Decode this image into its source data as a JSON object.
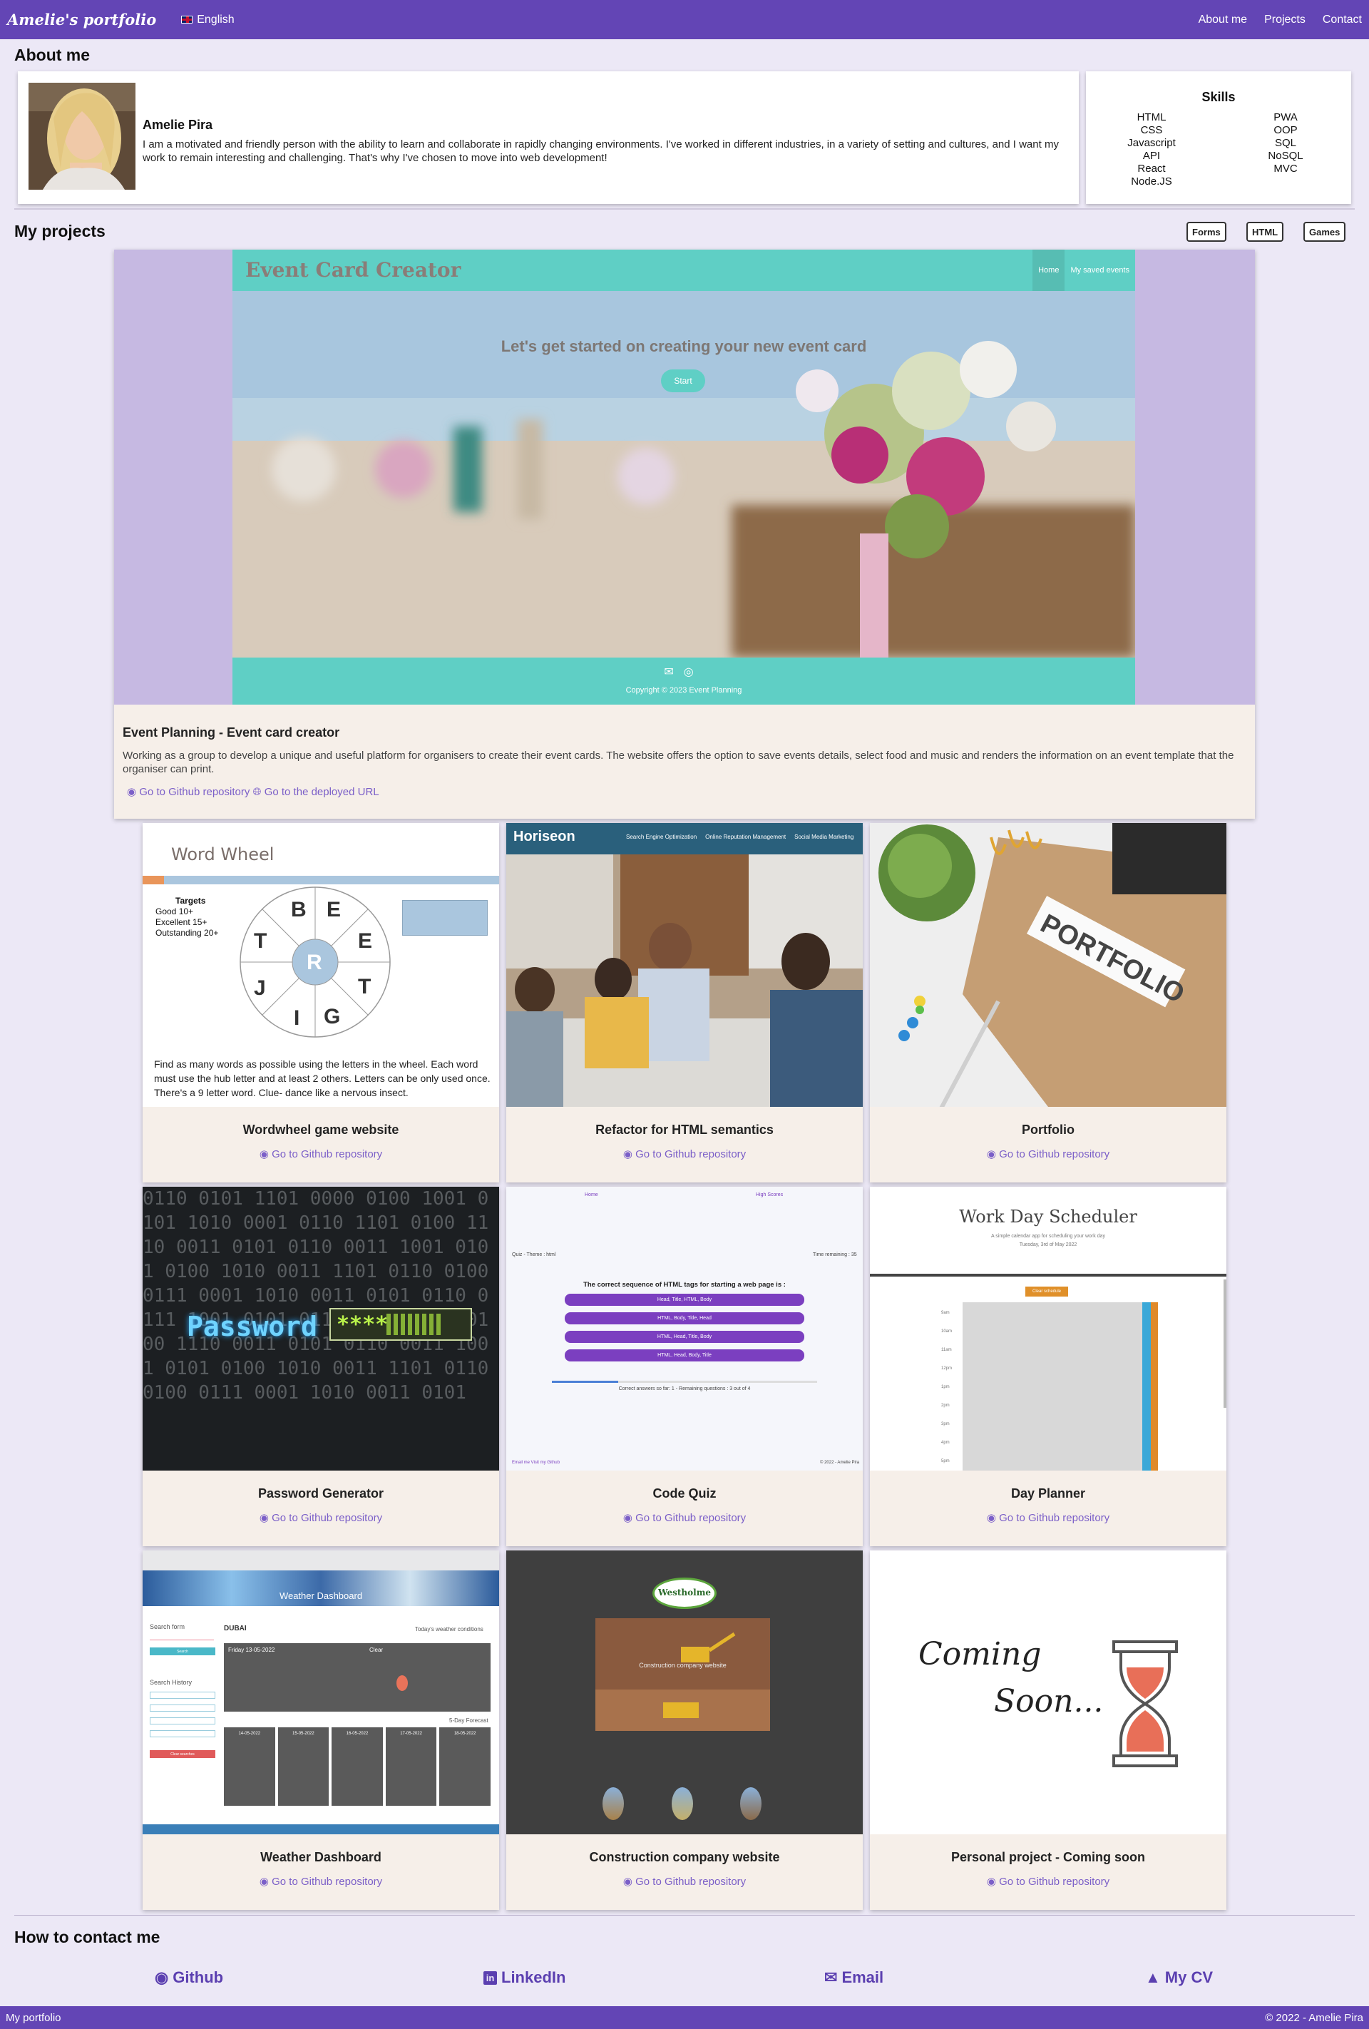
{
  "nav": {
    "brand": "Amelie's portfolio",
    "language": "English",
    "links": [
      "About me",
      "Projects",
      "Contact"
    ]
  },
  "about": {
    "title": "About me",
    "name": "Amelie Pira",
    "text": "I am a motivated and friendly person with the ability to learn and collaborate in rapidly changing environments. I've worked in different industries, in a variety of setting and cultures, and I want my work to remain interesting and challenging. That's why I've chosen to move into web development!",
    "skills_title": "Skills",
    "skills_left": [
      "HTML",
      "CSS",
      "Javascript",
      "API",
      "React",
      "Node.JS"
    ],
    "skills_right": [
      "PWA",
      "OOP",
      "SQL",
      "NoSQL",
      "MVC"
    ]
  },
  "projects": {
    "title": "My projects",
    "filters": [
      "Forms",
      "HTML",
      "Games"
    ],
    "featured": {
      "screenshot": {
        "title": "Event Card Creator",
        "nav_home": "Home",
        "nav_saved": "My saved events",
        "message": "Let's get started on creating your new event card",
        "start": "Start",
        "copyright": "Copyright © 2023 Event Planning"
      },
      "title": "Event Planning - Event card creator",
      "description": "Working as a group to develop a unique and useful platform for organisers to create their event cards. The website offers the option to save events details, select food and music and renders the information on an event template that the organiser can print.",
      "repo_link": "Go to Github repository",
      "deploy_link": "Go to the deployed URL"
    },
    "cards": [
      {
        "title": "Wordwheel game website",
        "link": "Go to Github repository"
      },
      {
        "title": "Refactor for HTML semantics",
        "link": "Go to Github repository"
      },
      {
        "title": "Portfolio",
        "link": "Go to Github repository"
      },
      {
        "title": "Password Generator",
        "link": "Go to Github repository"
      },
      {
        "title": "Code Quiz",
        "link": "Go to Github repository"
      },
      {
        "title": "Day Planner",
        "link": "Go to Github repository"
      },
      {
        "title": "Weather Dashboard",
        "link": "Go to Github repository"
      },
      {
        "title": "Construction company website",
        "link": "Go to Github repository"
      },
      {
        "title": "Personal project - Coming soon",
        "link": "Go to Github repository"
      }
    ],
    "thumbs": {
      "wordwheel": {
        "title": "Word Wheel",
        "targets": "Targets",
        "good": "Good 10+",
        "excellent": "Excellent 15+",
        "outstanding": "Outstanding 20+",
        "letters": [
          "B",
          "E",
          "E",
          "T",
          "G",
          "I",
          "J",
          "T"
        ],
        "center": "R",
        "instructions": "Find as many words as possible using the letters in the wheel. Each word must use the hub letter and at least 2 others. Letters can be only used once. There's a 9 letter word. Clue- dance like a nervous insect."
      },
      "horiseon": {
        "logo": "Horiseon",
        "nav": [
          "Search Engine Optimization",
          "Online Reputation Management",
          "Social Media Marketing"
        ]
      },
      "portfolio_label": "PORTFOLIO",
      "password": {
        "word": "Password",
        "stars": "****"
      },
      "quiz": {
        "home": "Home",
        "scores": "High Scores",
        "theme": "Quiz - Theme : html",
        "time": "Time remaining :   35",
        "question": "The correct sequence of HTML tags for starting a web page is :",
        "answers": [
          "Head, Title, HTML, Body",
          "HTML, Body, Title, Head",
          "HTML, Head, Title, Body",
          "HTML, Head, Body, Title"
        ],
        "progress": "Correct answers so far: 1 - Remaining questions : 3 out of 4",
        "footer_left": "Email me   Visit my Github",
        "footer_right": "© 2022 - Amelie Pira"
      },
      "planner": {
        "title": "Work Day Scheduler",
        "subtitle": "A simple calendar app for scheduling your work day",
        "date": "Tuesday, 3rd of May 2022",
        "button": "Clear schedule",
        "hours": [
          "9am",
          "10am",
          "11am",
          "12pm",
          "1pm",
          "2pm",
          "3pm",
          "4pm",
          "5pm"
        ]
      },
      "weather": {
        "header": "Weather Dashboard",
        "search_label": "Search form",
        "search_btn": "Search",
        "history": "Search History",
        "clear_btn": "Clear searches",
        "city": "DUBAI",
        "today": "Today's weather conditions",
        "date": "Friday 13-05-2022",
        "condition": "Clear",
        "forecast": "5-Day Forecast",
        "days": [
          "14-05-2022",
          "15-05-2022",
          "16-05-2022",
          "17-05-2022",
          "18-05-2022"
        ]
      },
      "construction": {
        "logo": "Westholme",
        "caption": "Construction company website"
      },
      "coming": {
        "line1": "Coming",
        "line2": "Soon..."
      }
    }
  },
  "contact": {
    "title": "How to contact me",
    "links": [
      "Github",
      "LinkedIn",
      "Email",
      "My CV"
    ]
  },
  "footer": {
    "left": "My portfolio",
    "right": "© 2022 - Amelie Pira"
  }
}
